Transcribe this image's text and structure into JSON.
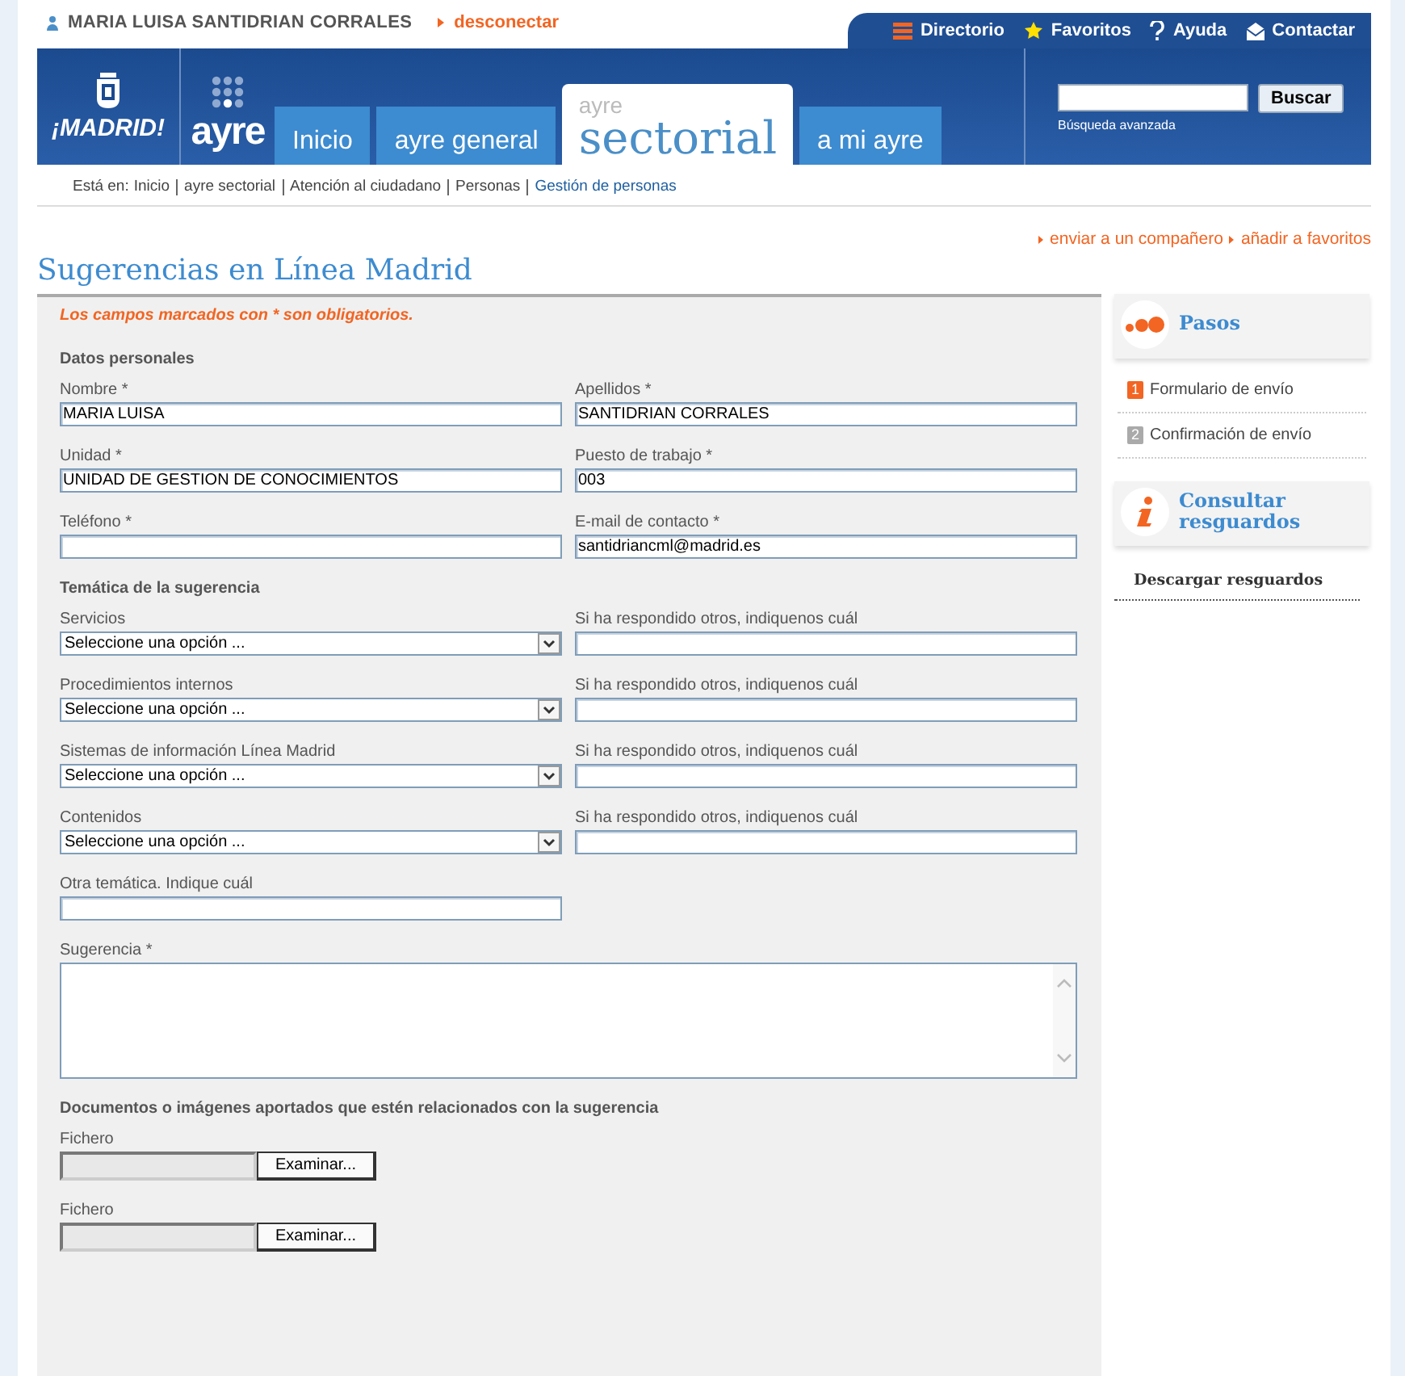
{
  "user_bar": {
    "user": "MARIA LUISA SANTIDRIAN CORRALES",
    "logout": "desconectar"
  },
  "top_links": [
    {
      "label": "Directorio"
    },
    {
      "label": "Favoritos"
    },
    {
      "label": "Ayuda"
    },
    {
      "label": "Contactar"
    }
  ],
  "logos": {
    "city": "¡MADRID!",
    "ayre": "ayre"
  },
  "tabs": [
    {
      "label": "Inicio",
      "selected": false
    },
    {
      "label": "ayre general",
      "selected": false
    },
    {
      "prefix": "ayre",
      "label": "sectorial",
      "selected": true
    },
    {
      "label": "a mi ayre",
      "selected": false
    }
  ],
  "search": {
    "button": "Buscar",
    "advanced": "Búsqueda avanzada"
  },
  "breadcrumb": {
    "prefix": "Está en:",
    "items": [
      {
        "label": "Inicio",
        "current": false
      },
      {
        "label": "ayre sectorial",
        "current": false
      },
      {
        "label": "Atención al ciudadano",
        "current": false
      },
      {
        "label": "Personas",
        "current": false
      },
      {
        "label": "Gestión de personas",
        "current": true
      }
    ]
  },
  "page_links": [
    "enviar a un compañero",
    "añadir a favoritos"
  ],
  "title": "Sugerencias en Línea Madrid",
  "form": {
    "note": "Los campos marcados con * son obligatorios.",
    "sections": [
      {
        "heading": "Datos personales",
        "rows": [
          [
            {
              "label": "Nombre *",
              "kind": "text",
              "value": "MARIA LUISA"
            },
            {
              "label": "Apellidos *",
              "kind": "text",
              "value": "SANTIDRIAN CORRALES"
            }
          ],
          [
            {
              "label": "Unidad *",
              "kind": "text",
              "value": "UNIDAD DE GESTION DE CONOCIMIENTOS"
            },
            {
              "label": "Puesto de trabajo *",
              "kind": "text",
              "value": "003"
            }
          ],
          [
            {
              "label": "Teléfono *",
              "kind": "text"
            },
            {
              "label": "E-mail de contacto *",
              "kind": "text",
              "value": "santidriancml@madrid.es"
            }
          ]
        ]
      },
      {
        "heading": "Temática de la sugerencia",
        "rows": [
          [
            {
              "label": "Servicios",
              "kind": "select",
              "value": "Seleccione una opción ..."
            },
            {
              "label": "Si ha respondido otros, indiquenos cuál",
              "kind": "text"
            }
          ],
          [
            {
              "label": "Procedimientos internos",
              "kind": "select",
              "value": "Seleccione una opción ..."
            },
            {
              "label": "Si ha respondido otros, indiquenos cuál",
              "kind": "text"
            }
          ],
          [
            {
              "label": "Sistemas de información Línea Madrid",
              "kind": "select",
              "value": "Seleccione una opción ..."
            },
            {
              "label": "Si ha respondido otros, indiquenos cuál",
              "kind": "text"
            }
          ],
          [
            {
              "label": "Contenidos",
              "kind": "select",
              "value": "Seleccione una opción ..."
            },
            {
              "label": "Si ha respondido otros, indiquenos cuál",
              "kind": "text"
            }
          ],
          [
            {
              "label": "Otra temática. Indique cuál",
              "kind": "text"
            }
          ]
        ]
      },
      {
        "rows": [
          [
            {
              "label": "Sugerencia *",
              "kind": "textarea"
            }
          ]
        ]
      },
      {
        "heading": "Documentos o imágenes aportados que estén relacionados con la sugerencia",
        "rows": [
          [
            {
              "label": "Fichero",
              "kind": "file",
              "button": "Examinar..."
            }
          ],
          [
            {
              "label": "Fichero",
              "kind": "file",
              "button": "Examinar..."
            }
          ]
        ]
      }
    ]
  },
  "sidebar": {
    "steps_title": "Pasos",
    "steps": [
      {
        "number": "1",
        "label": "Formulario de envío",
        "selected": true
      },
      {
        "number": "2",
        "label": "Confirmación de envío",
        "selected": false
      }
    ],
    "receipts_title": "Consultar resguardos",
    "receipts_link": "Descargar resguardos"
  }
}
